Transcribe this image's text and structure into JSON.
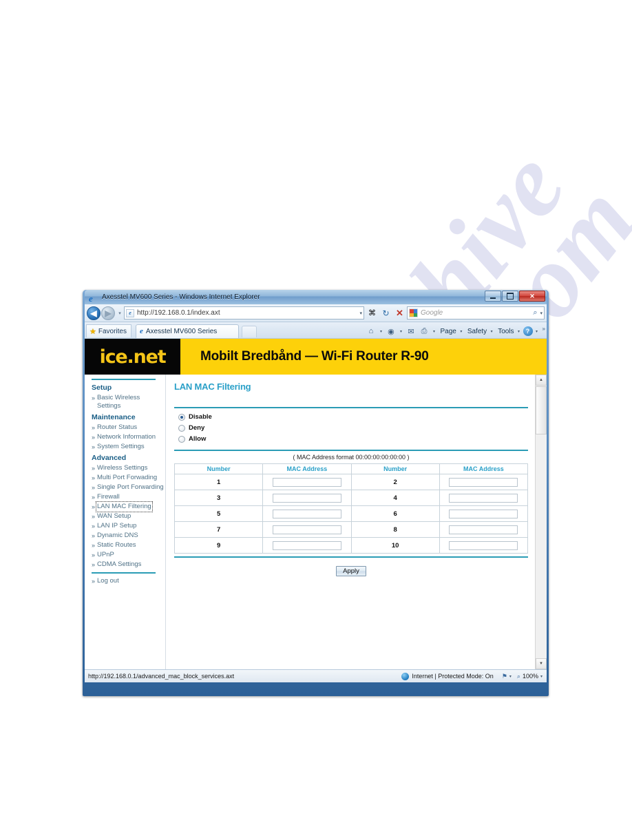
{
  "window": {
    "title": "Axesstel MV600 Series - Windows Internet Explorer",
    "minimize_label": "Minimize",
    "restore_label": "Restore",
    "close_label": "✕"
  },
  "address_bar": {
    "url_protocol": "http://",
    "url_host": "192.168.0.1",
    "url_path": "/index.axt",
    "url_full": "http://192.168.0.1/index.axt",
    "back_label": "◀",
    "forward_label": "▶",
    "history_caret": "▾",
    "url_caret": "▾",
    "compat_label": "⌘",
    "refresh_label": "↻",
    "stop_label": "✕",
    "search_placeholder": "Google",
    "search_value": "",
    "search_go": "⌕",
    "search_caret": "▾"
  },
  "favorites_bar": {
    "favorites_label": "Favorites",
    "star_glyph": "★"
  },
  "tabs": [
    {
      "label": "Axesstel MV600 Series",
      "icon": "e"
    }
  ],
  "command_bar": {
    "home_icon": "⌂",
    "feeds_icon": "◉",
    "mail_icon": "✉",
    "print_icon": "⎙",
    "caret": "▾",
    "items": [
      {
        "label": "Page"
      },
      {
        "label": "Safety"
      },
      {
        "label": "Tools"
      }
    ],
    "help_icon": "?",
    "overflow": "»"
  },
  "banner": {
    "logo": "ice.net",
    "title": "Mobilt Bredbånd — Wi-Fi Router R-90",
    "logo_bg": "#060606",
    "logo_fg": "#f5c518",
    "banner_bg": "#fdd10a"
  },
  "sidebar": {
    "chevron": "»",
    "groups": [
      {
        "heading": "Setup",
        "items": [
          {
            "label": "Basic Wireless Settings",
            "active": false
          }
        ]
      },
      {
        "heading": "Maintenance",
        "items": [
          {
            "label": "Router Status",
            "active": false
          },
          {
            "label": "Network Information",
            "active": false
          },
          {
            "label": "System Settings",
            "active": false
          }
        ]
      },
      {
        "heading": "Advanced",
        "items": [
          {
            "label": "Wireless Settings",
            "active": false
          },
          {
            "label": "Multi Port Forwading",
            "active": false
          },
          {
            "label": "Single Port Forwarding",
            "active": false
          },
          {
            "label": "Firewall",
            "active": false
          },
          {
            "label": "LAN MAC Filtering",
            "active": true
          },
          {
            "label": "WAN Setup",
            "active": false
          },
          {
            "label": "LAN IP Setup",
            "active": false
          },
          {
            "label": "Dynamic DNS",
            "active": false
          },
          {
            "label": "Static Routes",
            "active": false
          },
          {
            "label": "UPnP",
            "active": false
          },
          {
            "label": "CDMA Settings",
            "active": false
          }
        ]
      }
    ],
    "logout": {
      "label": "Log out"
    },
    "accent_color": "#2a9cb5"
  },
  "main": {
    "page_title": "LAN MAC Filtering",
    "title_color": "#2aa0c8",
    "filter_modes": [
      {
        "label": "Disable",
        "selected": true
      },
      {
        "label": "Deny",
        "selected": false
      },
      {
        "label": "Allow",
        "selected": false
      }
    ],
    "format_hint": "( MAC Address format 00:00:00:00:00:00 )",
    "table": {
      "headers": [
        "Number",
        "MAC Address",
        "Number",
        "MAC Address"
      ],
      "rows": [
        {
          "n1": "1",
          "mac1": "",
          "n2": "2",
          "mac2": ""
        },
        {
          "n1": "3",
          "mac1": "",
          "n2": "4",
          "mac2": ""
        },
        {
          "n1": "5",
          "mac1": "",
          "n2": "6",
          "mac2": ""
        },
        {
          "n1": "7",
          "mac1": "",
          "n2": "8",
          "mac2": ""
        },
        {
          "n1": "9",
          "mac1": "",
          "n2": "10",
          "mac2": ""
        }
      ]
    },
    "apply_label": "Apply"
  },
  "scrollbar": {
    "up_arrow": "▲",
    "down_arrow": "▼"
  },
  "status_bar": {
    "url": "http://192.168.0.1/advanced_mac_block_services.axt",
    "zone": "Internet | Protected Mode: On",
    "zone_caret": "▾",
    "privacy_icon": "⚑",
    "zoom_icon": "⌕",
    "zoom_level": "100%",
    "zoom_caret": "▾"
  },
  "watermark": {
    "line1": "manualshive",
    "line2": ".com"
  }
}
